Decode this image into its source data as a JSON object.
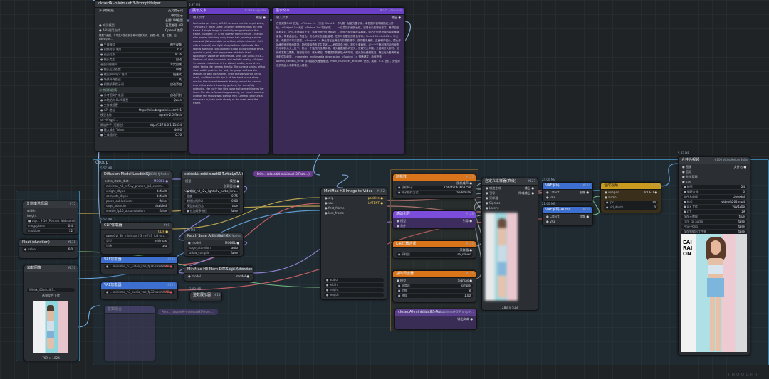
{
  "group": {
    "title": "Group"
  },
  "prompt_helper": {
    "title": "closedAI-minimaxH3-PromptHelper",
    "rows": [
      {
        "label": "多参数模板",
        "value": "英文提示词"
      },
      {
        "label": "",
        "value": "中文显示"
      },
      {
        "label": "",
        "value": "长描LLM模型"
      },
      {
        "label": "● 知识模型",
        "value": "百度推理 API"
      },
      {
        "label": "● API 调用方式",
        "value": "OpenAI 兼容"
      }
    ],
    "desc": "根据下面图，本项生产提供的多种可能的方式，长镜一样，语、主题、加 admin/un...",
    "options": [
      {
        "label": "● 生成模式",
        "value": "图生视频"
      },
      {
        "label": "● 视频时长 (秒)",
        "value": "6 s"
      },
      {
        "label": "● 画面比例",
        "value": "9:16"
      },
      {
        "label": "● 镜头类型",
        "value": "自动"
      },
      {
        "label": "画面风格倾向",
        "value": "写实自然"
      },
      {
        "label": "● 镜头运动强度",
        "value": "中等"
      },
      {
        "label": "● 输出 Prompt 格式",
        "value": "段落式"
      },
      {
        "label": "● 场景补充描述",
        "value": "关"
      },
      {
        "label": "● 视频帧率提示词",
        "value": "自动添加"
      }
    ],
    "section2": "参考源和剧情",
    "extra": [
      {
        "label": "● 参考图文件来源",
        "value": "自动识别"
      },
      {
        "label": "● 本地结构 LLM 模型",
        "value": "Qwen"
      },
      {
        "label": "● 工作流设置",
        "value": ""
      },
      {
        "label": "● API 地址",
        "value": "https://aihub.agrain.io.com/v1"
      },
      {
        "label": "模型名称",
        "value": "agrain-2.5-flash"
      },
      {
        "label": "sk-H9Ygp3...",
        "value": "******"
      },
      {
        "label": "随机种子 (可留空)",
        "value": "http://127.0.0.1:11434"
      },
      {
        "label": "● 最大输出 Token",
        "value": "4096"
      },
      {
        "label": "● 生成随机性",
        "value": "0.70"
      }
    ]
  },
  "show_text_a": {
    "title": "展示文本",
    "badge": "#148 Easy-Use",
    "label": "输入文本",
    "out": "输出 ●",
    "text": "For the target video, at 0:00 seconds into the target video, <Picture 1> (from Client 1) is fully referenced as the first frame. A single image is explicitly assigned as the first frame. <Subject 1> is the woman from <Picture 1> a tall, slim woman with long curly brown hair, wearing a white crop vest (Western-style corset top, a light-blue mini skirt with a side slit) and light-blue platform high heels. She stands against a color-blocked studio background of white, cyan-blue, pink, and gray panels with bold black typography visible on the left side. Shot 1 at 00:00-0:03 — Medium full-shot, cinematic and realistic quality. <Subject 1> stands motionless in the vibrant studio, arms at her sides, facing the camera directly. The camera begins with a slow, subtle push in. Her body language shifts as she reaches up with both hands, grips the sides of the lifting mask, and theatrically rips it off her head in one sharp motion. She tosses the mask directly toward the camera lens with a violent throwing gesture, her arms fully extended. Her curly hair flies loose as the mask leaves her head. She stares forward aggressively, her mouth opening wide as she shouts with intense fury. Camera continues a slow push-in, then holds steady as the mask exits the frame."
  },
  "show_text_b": {
    "title": "展示文本",
    "badge": "#145 Easy-Use",
    "label": "输入文本",
    "out": "输出 ●",
    "text": "在视频第0.00 秒处，<Picture 1>（来自 Client 1）作为第一帧被完整引用。单张图片被明确指定为第一帧。<Subject 1> 来自 <Picture 1> 中的女性 —— 一位高挑纤细的女性，留着长长的棕色卷发，身穿白色露脐背心（西式紧身胸衣上衣，浅蓝色侧开叉迷你裙），搭配浅蓝色厚底高跟鞋。她站在色块拼接的摄影棚背景前，背景由白色、青蓝色、粉色和灰色面板组成，左侧可见醒目的黑色字体。Shot 1 00:00-0:03 — 中全景，电影感与写实质感。<Subject 1> 静止站在充满活力的摄影棚中，双臂垂于身侧，正面朝向镜头。镜头开始缓慢而轻微地推进。她的肢体语言发生变化——她双手向上伸，抓住头套两侧，以一个干脆利落的动作戏剧性地将其从头上扯下。她以一个猛烈的投掷手势，将头套直接扔向镜头，双臂完全伸展。头套离开头部时，她的卷发随之飘散。她怒目向前，张大嘴巴，带着强烈的愤怒大声呼喊。镜头持续缓慢推进，随后在头套离开画面时保持稳定。 Integrated_multimedia_description: <Subject 1> 情绪爆发，动作夸张。overall_camera_style: 手持感镜头缓慢推进。main_character_attitude: 愤怒、挑衅。n.b. 此处，女性角色的情绪从平静转变为爆发。"
  },
  "loader_panel": {
    "badge": "#75",
    "label": "分辨率选择器",
    "rows": [
      {
        "label": "width",
        "value": ""
      },
      {
        "label": "height",
        "value": ""
      }
    ],
    "wids": [
      {
        "label": "● asp... 9:16 (Portrait Widescreen)",
        "value": ""
      },
      {
        "label": "megapixels",
        "value": "0.4"
      },
      {
        "label": "multiple",
        "value": "32"
      }
    ],
    "float_title": "Float (duration)",
    "float_badge": "#131",
    "float_label": "● value",
    "float_value": "6.0",
    "load_title": "加载图像",
    "load_badge": "#116",
    "load_file": "Whisk_00a4cd83...",
    "load_upload": "选择文件上传",
    "load_caption": "769 × 1024"
  },
  "diffusion_loader": {
    "title": "Diffusion Model Loader KJ",
    "badge": "#134 (88N) KJNodes",
    "rows": [
      {
        "label": "extra_state_dict",
        "value": "MODEL ●"
      }
    ],
    "wids": [
      {
        "label": "minimax_h3_ref?vy_pruned_fp8_comm...",
        "value": ""
      },
      {
        "label": "weight_dtype",
        "value": "default"
      },
      {
        "label": "compute_dtype",
        "value": "default"
      },
      {
        "label": "patch_cublaslinear",
        "value": "false"
      },
      {
        "label": "sage_attention",
        "value": "disabled"
      },
      {
        "label": "enable_fp16_accumulation",
        "value": "false"
      }
    ]
  },
  "clip_loader": {
    "title": "CLIP加载器",
    "badge": "#60",
    "wids": [
      {
        "label": "qwen3vl_8b_minimax_h3_ref?v3_fp8_sca...",
        "value": ""
      },
      {
        "label": "类型",
        "value": "minimax"
      },
      {
        "label": "设备",
        "value": "cpu"
      }
    ],
    "out": "CLIP ●"
  },
  "vae_a": {
    "title": "VAE加载器",
    "badge": "#125",
    "wid": "● ... minimax_h3_video_vae_fp16.safetensors",
    "out": "VAE ●"
  },
  "vae_b": {
    "title": "VAE加载器",
    "badge": "#122",
    "wid": "● ... minimax_h3_audio_vae_fp32.safetensors",
    "out": "VAE ●"
  },
  "turbo_lora": {
    "title": "closedAI-minimaxH3-TurboLoRA-Pruned",
    "badge": "#154 closedAI-minimaxH3-PromptH...",
    "rows": [
      {
        "label": "模型",
        "value": "模型 ●"
      },
      {
        "label": "",
        "value": "创建日志 ●"
      }
    ],
    "wids": [
      {
        "label": "● 模型",
        "value": "minimax_h3_t2v_lightx2v_turbo_lora..."
      },
      {
        "label": "强度",
        "value": "0.75"
      },
      {
        "label": "剪除比例(%)",
        "value": "0.00"
      },
      {
        "label": "模型剪裁日志",
        "value": "true"
      },
      {
        "label": "● 仅加载多进程",
        "value": "false"
      },
      {
        "label": "● 调用 GPU 显存占用 (GB)",
        "value": "0.00"
      }
    ]
  },
  "patch_sage": {
    "title": "Patch Sage Attention KJ",
    "badge": "#136 (BETA) KJNodes",
    "rows": [
      {
        "label": "● model",
        "value": "MODEL ●"
      }
    ],
    "wids": [
      {
        "label": "sage_attention",
        "value": "auto"
      },
      {
        "label": "allow_compile",
        "value": "false"
      }
    ]
  },
  "dit_patch": {
    "title": "MiniMax H3 Mem DiT Sage Attention Patch",
    "badge": "#155 (BETA) KJNodes",
    "rows": [
      {
        "label": "● model",
        "value": "model ●"
      }
    ]
  },
  "blank_node": {
    "title": "整数展示器",
    "badge": "#156"
  },
  "minimax_i2v": {
    "title": "MiniMax H3 Image to Video",
    "badge": "#152",
    "inputs": [
      "clip",
      "vae",
      "first_frame",
      "last_frame"
    ],
    "outputs": [
      "positive ●",
      "LATENT ●"
    ],
    "bottom": [
      {
        "label": "● audio",
        "value": ""
      },
      {
        "label": "● width",
        "value": ""
      },
      {
        "label": "● height",
        "value": ""
      },
      {
        "label": "● length",
        "value": ""
      }
    ],
    "header_size": "288_1549"
  },
  "sampler_group": {
    "n1": {
      "title": "随机数",
      "badge": "#131",
      "wids": [
        {
          "label": "● 随机种子",
          "value": "724249063663758"
        },
        {
          "label": "● 种子操作方式",
          "value": "randomize"
        }
      ],
      "out": "随机噪声 ●"
    },
    "n2": {
      "title": "基础引导",
      "badge": "#128",
      "rows": [
        {
          "label": "● 模型",
          "value": "引导 ●"
        },
        {
          "label": "● 条件",
          "value": ""
        }
      ]
    },
    "n3": {
      "title": "K采样器选择",
      "badge": "#126",
      "wids": [
        {
          "label": "● 采样器",
          "value": "sa_solver"
        }
      ],
      "out": "采样器 ●"
    },
    "n4": {
      "title": "基础调度器",
      "badge": "#126",
      "rows": [
        {
          "label": "● 模型",
          "value": "Sigmas ●"
        }
      ],
      "wids": [
        {
          "label": "● 调度器",
          "value": "simple"
        },
        {
          "label": "● 步数",
          "value": "8"
        },
        {
          "label": "● 降噪",
          "value": "1.00"
        }
      ]
    },
    "n5": {
      "title": "closedAI-minimaxH3-Aut...",
      "badge": "#158 closedAI-minimaxH3-PromptH...",
      "out": "输出文本 ●"
    }
  },
  "advanced_sampler": {
    "title": "自定义采样器(高级)",
    "badge": "#127",
    "rows": [
      "噪波生成",
      "引导",
      "采样器",
      "Sigmas",
      "Latent"
    ],
    "outs": [
      "输出 ●",
      "降噪输出 ●"
    ],
    "caption": "288 × 513"
  },
  "vae_decode": {
    "title": "VAE解码",
    "badge": "#124",
    "rows": [
      {
        "label": "● Latent",
        "value": "图像 ●"
      },
      {
        "label": "● VAE",
        "value": ""
      }
    ]
  },
  "vae_decode_audio": {
    "title": "VAE解码 Audio",
    "badge": "#129",
    "rows": [
      {
        "label": "● Latent",
        "value": "音频 ●"
      },
      {
        "label": "● VAE",
        "value": ""
      }
    ]
  },
  "merge_node": {
    "title": "合成视频",
    "badge": "#132",
    "rows": [
      {
        "label": "● images",
        "value": "VIDEO ●"
      },
      {
        "label": "● audio",
        "value": ""
      }
    ],
    "wids": [
      {
        "label": "● fps",
        "value": "24"
      },
      {
        "label": "● vid_depth",
        "value": "0"
      }
    ]
  },
  "video_combine": {
    "title": "合并为视频",
    "badge": "#106 VideoHelperSuite",
    "rows": [
      {
        "label": "● 图像",
        "value": "文件名 ●"
      },
      {
        "label": "● 音频",
        "value": ""
      },
      {
        "label": "● 批次管理",
        "value": ""
      },
      {
        "label": "● vae",
        "value": ""
      }
    ],
    "wids": [
      {
        "label": "● 帧率",
        "value": "24"
      },
      {
        "label": "● 循环次数",
        "value": "0"
      },
      {
        "label": "文件名前缀",
        "value": "closedAI"
      },
      {
        "label": "● 格式",
        "value": "video/h264-mp4"
      },
      {
        "label": "● pix_fmt",
        "value": "yuv420p"
      },
      {
        "label": "● crf",
        "value": "19"
      },
      {
        "label": "保存元数据",
        "value": "true"
      },
      {
        "label": "trim_to_audio",
        "value": "false"
      },
      {
        "label": "Ping-Pong",
        "value": "false"
      },
      {
        "label": "保存到输出文件夹",
        "value": "false"
      }
    ],
    "side_text": "EAI RAI ON"
  },
  "side_badges": {
    "left_a": "5.57 MB",
    "left_b": "5.57 MB",
    "mid_a": "3.93 MB",
    "mid_b": "3.00 MB",
    "right_a": "24.00 MB",
    "right_b": "21.00 MB",
    "top_c": "5.97 MB",
    "top_d": "5.97 MB"
  },
  "floating": {
    "pink": "Prim... (closedAI-minimaxH3-Prom...)",
    "dim": "Prim... (closedAI-minimaxH3-Prom...)",
    "loader_dim": "整数组合"
  },
  "watermark": "THOUGHT"
}
